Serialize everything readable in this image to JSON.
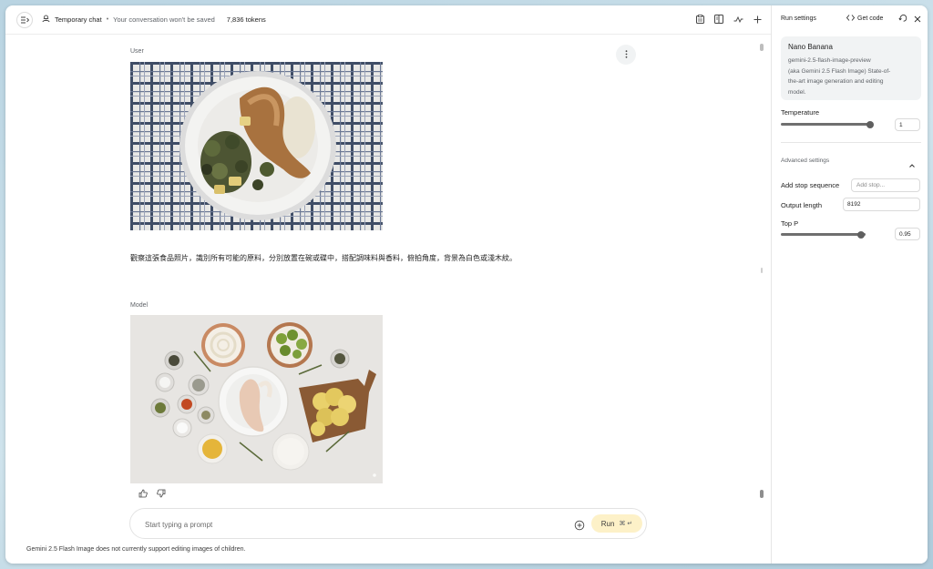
{
  "header": {
    "chat_title": "Temporary chat",
    "subtitle": "Your conversation won't be saved",
    "token_count": "7,836 tokens",
    "icons": [
      "sidebar-toggle-icon",
      "temporary-chat-icon",
      "clipboard-icon",
      "compare-icon",
      "shuffle-icon",
      "plus-icon"
    ]
  },
  "chat": {
    "user_role": "User",
    "user_prompt": "觀察這張食品照片，識別所有可能的原料，分別放置在碗或碟中，搭配調味料與香料，俯拍角度，背景為白色或淺木紋。",
    "model_role": "Model",
    "input_placeholder": "Start typing a prompt",
    "run_label": "Run",
    "run_shortcut": "⌘ ↵",
    "footnote": "Gemini 2.5 Flash Image does not currently support editing images of children."
  },
  "settings": {
    "title": "Run settings",
    "get_code": "Get code",
    "model_name": "Nano Banana",
    "model_desc_line1": "gemini-2.5-flash-image-preview",
    "model_desc_line2": "(aka Gemini 2.5 Flash Image) State-of-",
    "model_desc_line3": "the-art image generation and editing",
    "model_desc_line4": "model.",
    "temperature_label": "Temperature",
    "temperature_value": "1",
    "temperature_level": 1.0,
    "advanced_label": "Advanced settings",
    "stop_label": "Add stop sequence",
    "stop_placeholder": "Add stop...",
    "output_length_label": "Output length",
    "output_length_value": "8192",
    "top_p_label": "Top P",
    "top_p_value": "0.95",
    "top_p_level": 0.95
  },
  "colors": {
    "run_button_bg": "#fdf1c8",
    "card_bg": "#f1f3f4",
    "slider": "#6f6f6f"
  }
}
